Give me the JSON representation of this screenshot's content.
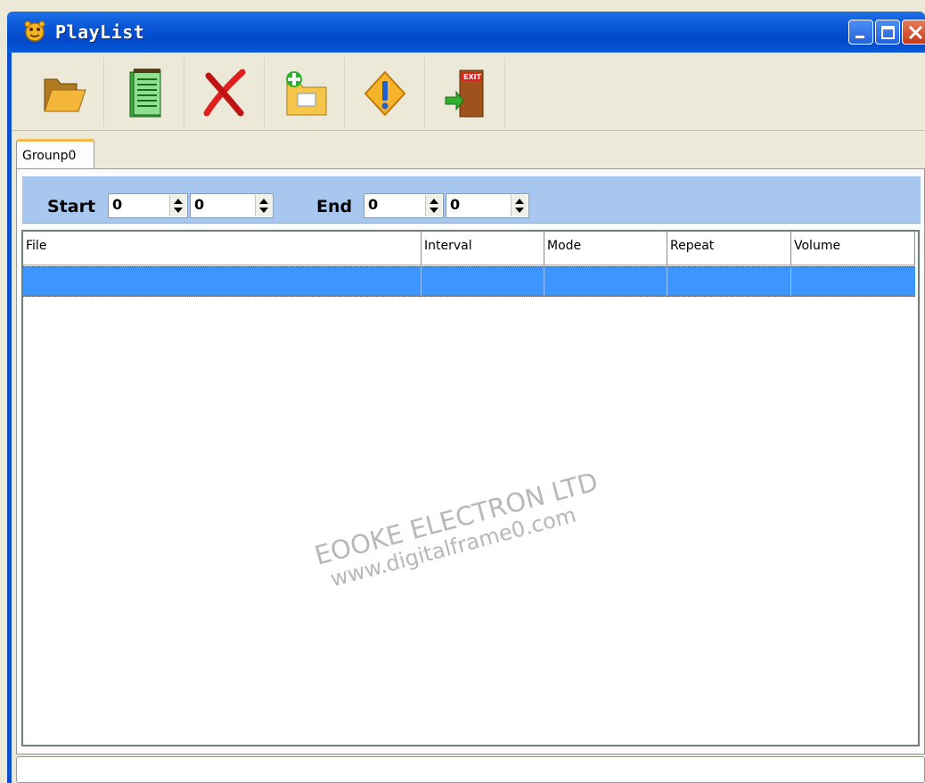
{
  "window": {
    "title": "PlayList"
  },
  "toolbar": {
    "buttons": [
      {
        "icon": "open-folder-icon"
      },
      {
        "icon": "notepad-icon"
      },
      {
        "icon": "delete-x-icon"
      },
      {
        "icon": "add-folder-icon"
      },
      {
        "icon": "warning-icon"
      },
      {
        "icon": "exit-door-icon"
      }
    ],
    "exit_sign": "EXIT"
  },
  "tabs": [
    {
      "label": "Grounp0"
    }
  ],
  "range": {
    "start_label": "Start",
    "end_label": "End",
    "start_values": [
      "0",
      "0"
    ],
    "end_values": [
      "0",
      "0"
    ]
  },
  "table": {
    "columns": [
      "File",
      "Interval",
      "Mode",
      "Repeat",
      "Volume"
    ],
    "rows": [
      [
        "",
        "",
        "",
        "",
        ""
      ]
    ]
  },
  "watermark": {
    "line1": "EOOKE ELECTRON LTD",
    "line2": "www.digitalframe0.com"
  },
  "colors": {
    "titlebar": "#0a58d8",
    "selection": "#3d95ff",
    "range_bar": "#a7c7ef"
  }
}
